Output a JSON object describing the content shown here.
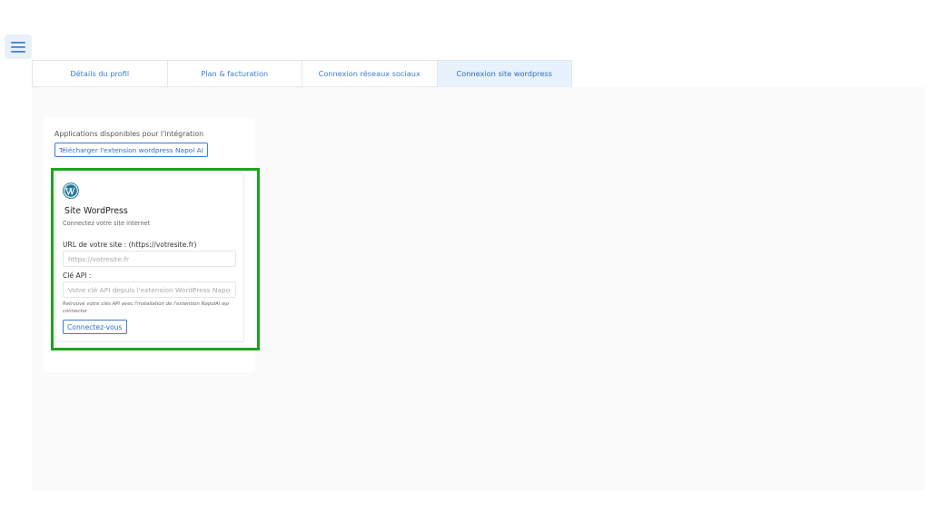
{
  "header": {
    "menu_icon": "hamburger-menu-icon"
  },
  "tabs": [
    {
      "label": "Détails du profil",
      "active": false
    },
    {
      "label": "Plan & facturation",
      "active": false
    },
    {
      "label": "Connexion réseaux sociaux",
      "active": false
    },
    {
      "label": "Connexion site wordpress",
      "active": true
    }
  ],
  "integrations": {
    "title": "Applications disponibles pour l'intégration",
    "download_label": "Télécharger l'extension wordpress Napol AI",
    "highlight_color": "#1fa31f",
    "card": {
      "icon": "wordpress-icon",
      "title": "Site WordPress",
      "subtitle": "Connectez votre site internet",
      "url_label": "URL de votre site : (https://votresite.fr)",
      "url_placeholder": "https://votresite.fr",
      "url_value": "",
      "api_label": "Clé API :",
      "api_placeholder": "Votre clé API depuis l'extension WordPress Napol",
      "api_value": "",
      "hint": "Retrouvé votre clés API avec l'installation de l'extention NapolAI wp connector",
      "connect_label": "Connectez-vous"
    }
  },
  "colors": {
    "accent": "#3b7dd8",
    "active_tab_bg": "#e8f2fc",
    "highlight": "#1fa31f"
  }
}
